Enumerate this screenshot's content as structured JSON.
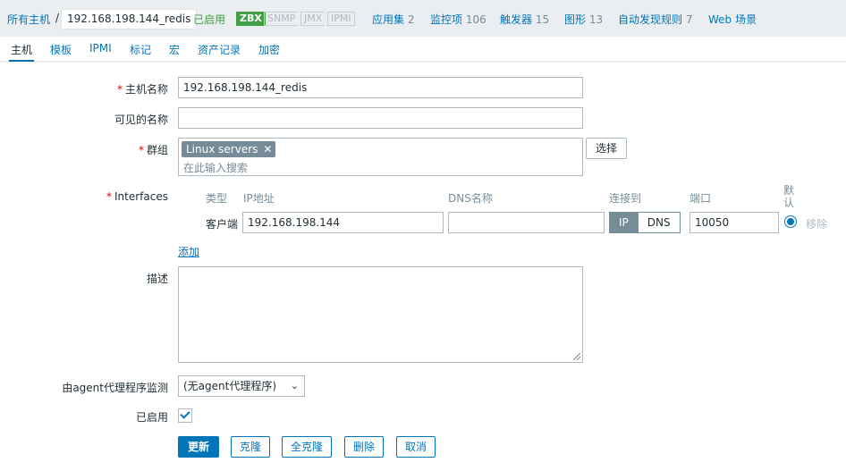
{
  "breadcrumb": {
    "all_hosts": "所有主机",
    "separator": "/",
    "current_host": "192.168.198.144_redis",
    "status": "已启用",
    "availability": [
      "ZBX",
      "SNMP",
      "JMX",
      "IPMI"
    ],
    "links": [
      {
        "label": "应用集",
        "count": "2"
      },
      {
        "label": "监控项",
        "count": "106"
      },
      {
        "label": "触发器",
        "count": "15"
      },
      {
        "label": "图形",
        "count": "13"
      },
      {
        "label": "自动发现规则",
        "count": "7"
      },
      {
        "label": "Web 场景",
        "count": ""
      }
    ]
  },
  "tabs": [
    "主机",
    "模板",
    "IPMI",
    "标记",
    "宏",
    "资产记录",
    "加密"
  ],
  "form": {
    "hostname_label": "主机名称",
    "hostname_value": "192.168.198.144_redis",
    "visible_name_label": "可见的名称",
    "visible_name_value": "",
    "groups_label": "群组",
    "group_chip": "Linux servers",
    "group_placeholder": "在此输入搜索",
    "select_button": "选择",
    "interfaces_label": "Interfaces",
    "iface_headers": {
      "type": "类型",
      "ip": "IP地址",
      "dns": "DNS名称",
      "connect": "连接到",
      "port": "端口",
      "default": "默认"
    },
    "iface_row": {
      "type": "客户端",
      "ip": "192.168.198.144",
      "dns": "",
      "connect_ip": "IP",
      "connect_dns": "DNS",
      "port": "10050",
      "remove": "移除"
    },
    "add_link": "添加",
    "description_label": "描述",
    "description_value": "",
    "proxy_label": "由agent代理程序监测",
    "proxy_value": "(无agent代理程序)",
    "enabled_label": "已启用",
    "enabled_checked": true
  },
  "buttons": {
    "update": "更新",
    "clone": "克隆",
    "full_clone": "全克隆",
    "delete": "删除",
    "cancel": "取消"
  }
}
